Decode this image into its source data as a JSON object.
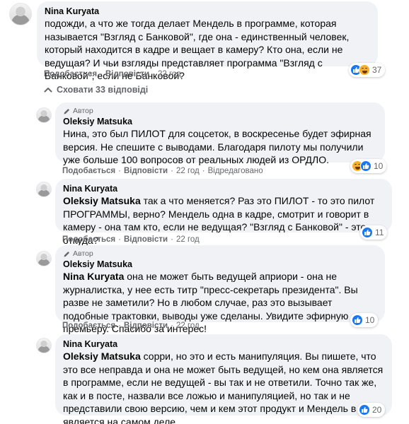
{
  "comments": [
    {
      "name": "Nina Kuryata",
      "text": "подожди, а что же тогда делает Мендель в программе, которая называется \"Взгляд с Банковой\", где она - единственный человек, который находится в кадре и вещает в камеру? Кто она, если не ведущая? И чьи взгляды представляет программа \"Взгляд с Банковой\", если не Банковой?",
      "actions": [
        "Подобається",
        "Відповісти"
      ],
      "time": "22 год",
      "reactions_count": "37"
    }
  ],
  "toggle_label": "Сховати 33 відповіді",
  "replies": [
    {
      "badge": "Автор",
      "name": "Oleksiy Matsuka",
      "text": "Нина, это был ПИЛОТ для соцсеток, в воскресенье будет эфирная версия. Не спешите с выводами. Благодаря пилоту мы получили уже больше 100 вопросов от реальных людей из ОРДЛО.",
      "actions": [
        "Подобається",
        "Відповісти"
      ],
      "time": "22 год",
      "edited": "Відредаговано",
      "reactions_count": "10"
    },
    {
      "name": "Nina Kuryata",
      "mention": "Oleksiy Matsuka",
      "text": "так а что меняется? Раз это ПИЛОТ - то это пилот ПРОГРАММЫ, верно? Мендель одна в кадре, смотрит и говорит в камеру - она там кто, если не ведущая? \"Взгляд с Банковой\" - это откуда?",
      "actions": [
        "Подобається",
        "Відповісти"
      ],
      "time": "22 год",
      "reactions_count": "11"
    },
    {
      "badge": "Автор",
      "name": "Oleksiy Matsuka",
      "mention": "Nina Kuryata",
      "text": "она не может быть ведущей априори - она не журналистка, у нее есть титр \"пресс-секретарь президента\". Вы разве не заметили? Но в любом случае, раз это вызывает подобные трактовки, выводы уже сделаны. Увидите эфирную премьеру. Спасибо за интерес!",
      "actions": [
        "Подобається",
        "Відповісти"
      ],
      "time": "22 год",
      "reactions_count": "10"
    },
    {
      "name": "Nina Kuryata",
      "mention": "Oleksiy Matsuka",
      "text": "сорри, но это и есть манипуляция. Вы пишете, что это все неправда и она не может быть ведущей, но кем она является в программе, если не ведущей - вы так и не ответили. Точно так же, как и в посте, назвали все ложью и манипуляцией, но так и не представили свою версию, чем и кем этот продукт и Мендель в нем является на самом деле",
      "reactions_count": "20"
    }
  ],
  "dot": "·",
  "colors": {
    "bubble": "#f0f2f5",
    "like": "#1877f2",
    "haha": "#f7b125",
    "meta": "#65676b"
  }
}
